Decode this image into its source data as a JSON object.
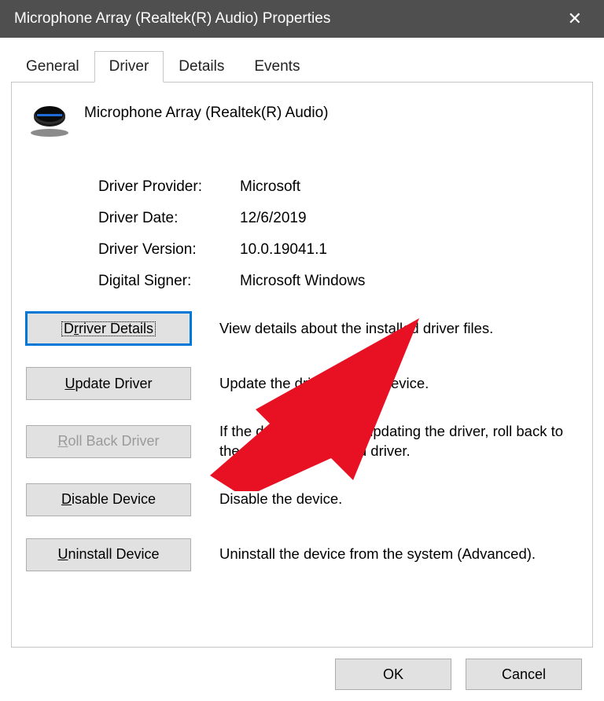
{
  "title": "Microphone Array (Realtek(R) Audio) Properties",
  "tabs": {
    "general": "General",
    "driver": "Driver",
    "details": "Details",
    "events": "Events"
  },
  "device_name": "Microphone Array (Realtek(R) Audio)",
  "info": {
    "provider_label": "Driver Provider:",
    "provider_value": "Microsoft",
    "date_label": "Driver Date:",
    "date_value": "12/6/2019",
    "version_label": "Driver Version:",
    "version_value": "10.0.19041.1",
    "signer_label": "Digital Signer:",
    "signer_value": "Microsoft Windows"
  },
  "actions": {
    "details_btn": "river Details",
    "details_desc": "View details about the installed driver files.",
    "update_btn": "pdate Driver",
    "update_desc": "Update the driver for this device.",
    "rollback_btn": "oll Back Driver",
    "rollback_desc": "If the device fails after updating the driver, roll back to the previously installed driver.",
    "disable_btn": "isable Device",
    "disable_desc": "Disable the device.",
    "uninstall_btn": "ninstall Device",
    "uninstall_desc": "Uninstall the device from the system (Advanced)."
  },
  "buttons": {
    "ok": "OK",
    "cancel": "Cancel"
  }
}
